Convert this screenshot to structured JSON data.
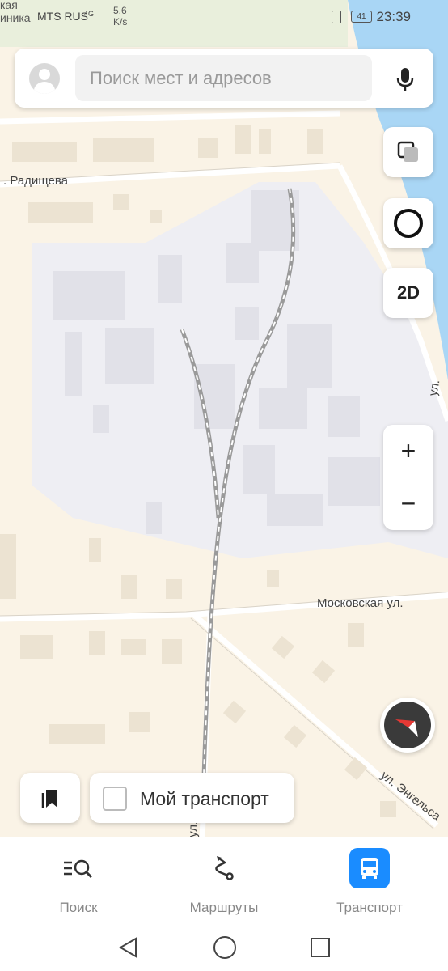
{
  "status_bar": {
    "left_street_fragment": "иника",
    "top_fragment": "кая",
    "carrier": "MTS RUS",
    "network": "4G",
    "speed_line1": "5,6",
    "speed_line2": "K/s",
    "battery": "41",
    "time": "23:39"
  },
  "search": {
    "placeholder": "Поиск мест и адресов"
  },
  "map": {
    "street_labels": {
      "radishcheva": ". Радищева",
      "moskovskaya": "Московская ул.",
      "engelsa": "ул. Энгельса",
      "ul_right": "ул.",
      "ul_bottom": "ул."
    }
  },
  "controls": {
    "mode_label": "2D",
    "zoom_in": "+",
    "zoom_out": "−"
  },
  "transport_toggle": {
    "label": "Мой транспорт",
    "checked": false
  },
  "tabs": [
    {
      "label": "Поиск",
      "icon": "search-list-icon",
      "active": false
    },
    {
      "label": "Маршруты",
      "icon": "route-icon",
      "active": false
    },
    {
      "label": "Транспорт",
      "icon": "bus-icon",
      "active": true
    }
  ],
  "colors": {
    "accent": "#1a8cff",
    "map_background": "#faf3e6",
    "industrial_zone": "#eeeef3",
    "water": "#a9d6f5"
  }
}
